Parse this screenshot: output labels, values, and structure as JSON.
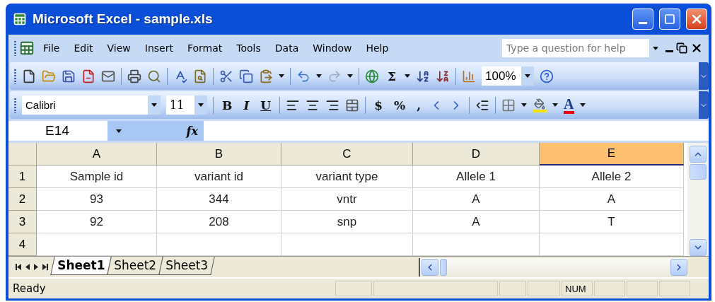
{
  "window": {
    "title": "Microsoft Excel - sample.xls"
  },
  "menu": {
    "items": [
      "File",
      "Edit",
      "View",
      "Insert",
      "Format",
      "Tools",
      "Data",
      "Window",
      "Help"
    ],
    "help_search": {
      "placeholder": "Type a question for help"
    }
  },
  "standard_toolbar": {
    "sum": "Σ",
    "zoom": "100%"
  },
  "formatting_toolbar": {
    "font": "Calibri",
    "size": "11",
    "bold": "B",
    "italic": "I",
    "underline": "U",
    "currency": "$",
    "percent": "%",
    "comma": ",",
    "font_color": "A"
  },
  "formula_bar": {
    "name_box": "E14",
    "function_label": "fx"
  },
  "sheet": {
    "columns": [
      {
        "label": "A",
        "selected": false
      },
      {
        "label": "B",
        "selected": false
      },
      {
        "label": "C",
        "selected": false
      },
      {
        "label": "D",
        "selected": false
      },
      {
        "label": "E",
        "selected": true
      }
    ],
    "rows": [
      {
        "header": "1",
        "cells": [
          "Sample id",
          "variant id",
          "variant type",
          "Allele 1",
          "Allele 2"
        ]
      },
      {
        "header": "2",
        "cells": [
          "93",
          "344",
          "vntr",
          "A",
          "A"
        ]
      },
      {
        "header": "3",
        "cells": [
          "92",
          "208",
          "snp",
          "A",
          "T"
        ]
      },
      {
        "header": "4"
      }
    ]
  },
  "sheet_tabs": [
    {
      "label": "Sheet1",
      "selected": true
    },
    {
      "label": "Sheet2",
      "selected": false
    },
    {
      "label": "Sheet3",
      "selected": false
    }
  ],
  "status_bar": {
    "text": "Ready",
    "num": "NUM"
  }
}
